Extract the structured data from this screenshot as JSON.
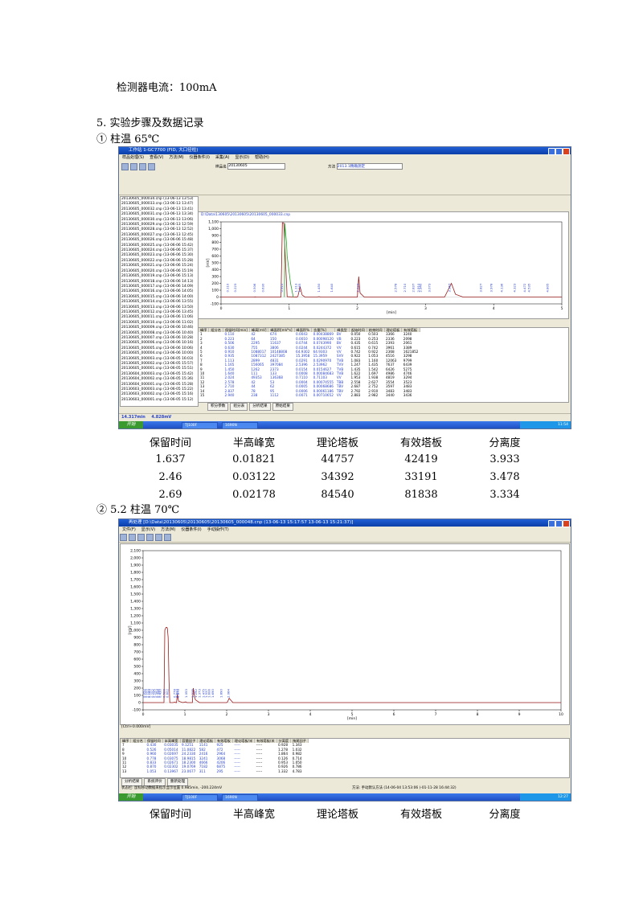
{
  "doc": {
    "detector_current": "检测器电流：100mA",
    "section_heading": "5.  实验步骤及数据记录",
    "item1": "①  柱温 65℃",
    "item2": "②  5.2 柱温 70℃",
    "table_headers": [
      "保留时间",
      "半高峰宽",
      "理论塔板",
      "有效塔板",
      "分离度"
    ],
    "table_rows": [
      [
        "1.637",
        "0.01821",
        "44757",
        "42419",
        "3.933"
      ],
      [
        "2.46",
        "0.03122",
        "34392",
        "33191",
        "3.478"
      ],
      [
        "2.69",
        "0.02178",
        "84540",
        "81838",
        "3.334"
      ]
    ],
    "table2_headers": [
      "保留时间",
      "半高峰宽",
      "理论塔板",
      "有效塔板",
      "分离度"
    ]
  },
  "shot1": {
    "title": "工作站 1-GC7700 (FID, 大口径柱)",
    "menu": [
      "样品处理(S)",
      "查看(V)",
      "方法(M)",
      "仪器条件(I)",
      "采集(A)",
      "显示(D)",
      "帮助(H)"
    ],
    "sample_label": "样品名",
    "sample_value": "20130605",
    "method_label": "方法",
    "method_value": "2013.1精确测定",
    "file_path": "D:\\Data\\130605\\20130605\\20130605_000033.cnp",
    "side_files": [
      "20130605_000034.cnp (13-06-13 13:53)",
      "20130605_000033.cnp (13-06-13 13:47)",
      "20130605_000032.cnp (13-06-13 13:41)",
      "20130605_000031.cnp (13-06-13 13:34)",
      "20130605_000030.cnp (13-06-13 13:06)",
      "20130605_000029.cnp (13-06-13 12:59)",
      "20130605_000028.cnp (13-06-13 12:52)",
      "20130605_000027.cnp (13-06-13 12:45)",
      "20130605_000026.cnp (13-06-06 15:48)",
      "20130605_000025.cnp (13-06-06 15:42)",
      "20130605_000024.cnp (13-06-06 15:37)",
      "20130605_000023.cnp (13-06-06 15:30)",
      "20130605_000022.cnp (13-06-06 15:28)",
      "20130605_000021.cnp (13-06-06 15:24)",
      "20130605_000020.cnp (13-06-06 15:19)",
      "20130605_000019.cnp (13-06-06 15:13)",
      "20130605_000018.cnp (13-06-06 14:13)",
      "20130605_000017.cnp (13-06-06 14:09)",
      "20130605_000016.cnp (13-06-06 14:05)",
      "20130605_000015.cnp (13-06-06 14:00)",
      "20130605_000014.cnp (13-06-06 13:55)",
      "20130605_000013.cnp (13-06-06 13:50)",
      "20130605_000012.cnp (13-06-06 13:45)",
      "20130605_000011.cnp (13-06-06 11:06)",
      "20130605_000010.cnp (13-06-06 11:02)",
      "20130605_000009.cnp (13-06-06 10:46)",
      "20130605_000008.cnp (13-06-06 10:40)",
      "20130605_000007.cnp (13-06-06 10:28)",
      "20130605_000006.cnp (13-06-06 10:16)",
      "20130605_000005.cnp (13-06-06 10:06)",
      "20130605_000004.cnp (13-06-06 10:00)",
      "20130605_000003.cnp (13-06-05 16:03)",
      "20130605_000002.cnp (13-06-05 15:57)",
      "20130605_000001.cnp (13-06-05 15:51)",
      "20130604_000003.cnp (13-06-05 15:42)",
      "20130604_000002.cnp (13-06-05 15:36)",
      "20130604_000001.cnp (13-06-05 15:28)",
      "20130603_000003.cnp (13-06-05 15:22)",
      "20130603_000002.cnp (13-06-05 15:16)",
      "20130603_000001.cnp (13-06-05 15:12)"
    ],
    "status_time": "14.317min",
    "status_value": "4.828mV",
    "tabs": [
      "积分参数",
      "组分表",
      "分析结果",
      "原始结果"
    ],
    "table_headers": [
      "峰序",
      "组分名",
      "保留时间[min]",
      "峰高[mV]",
      "峰面积[mV*s]",
      "峰面积%",
      "含量[%]",
      "峰类型",
      "起始时间",
      "结束时间",
      "理论塔板",
      "有效塔板"
    ],
    "table_rows": [
      [
        "1",
        "",
        "0.110",
        "42",
        "674",
        "0.0043",
        "0.00438869",
        "BV",
        "0.050",
        "0.503",
        "3366",
        "3240"
      ],
      [
        "2",
        "",
        "0.223",
        "64",
        "150",
        "0.0010",
        "0.00098120",
        "VB",
        "0.223",
        "0.253",
        "2336",
        "2098"
      ],
      [
        "3",
        "",
        "0.506",
        "2295",
        "11637",
        "0.0744",
        "0.0743990",
        "BV",
        "0.435",
        "0.615",
        "2393",
        "2061"
      ],
      [
        "4",
        "",
        "0.630",
        "755",
        "3806",
        "0.0244",
        "0.0244372",
        "VV",
        "0.615",
        "0.742",
        "3961",
        "3389"
      ],
      [
        "5",
        "",
        "0.910",
        "1088017",
        "10148808",
        "64.9302",
        "64.9303",
        "VV",
        "0.742",
        "0.922",
        "2368",
        "1621852"
      ],
      [
        "6",
        "",
        "0.935",
        "1087312",
        "2427385",
        "15.3958",
        "15.3959",
        "SVV",
        "0.922",
        "1.053",
        "4516",
        "3298"
      ],
      [
        "7",
        "",
        "1.113",
        "2899",
        "4831",
        "0.0291",
        "0.0290970",
        "TVB",
        "1.083",
        "1.160",
        "12063",
        "9799"
      ],
      [
        "8",
        "",
        "1.165",
        "156065",
        "397084",
        "2.5396",
        "2.53962",
        "TVV",
        "1.247",
        "1.435",
        "7637",
        "6439"
      ],
      [
        "9",
        "",
        "1.450",
        "1262",
        "2373",
        "0.0154",
        "0.0154627",
        "TVB",
        "1.435",
        "1.542",
        "6426",
        "5275"
      ],
      [
        "10",
        "",
        "1.640",
        "111",
        "133",
        "0.0008",
        "0.00084683",
        "TVB",
        "1.622",
        "1.697",
        "4986",
        "4746"
      ],
      [
        "11",
        "",
        "2.024",
        "49353",
        "136368",
        "0.7110",
        "0.71103",
        "VV",
        "1.953",
        "1.938",
        "4819",
        "3294"
      ],
      [
        "12",
        "",
        "2.578",
        "42",
        "53",
        "0.0004",
        "0.00074555",
        "TBB",
        "2.558",
        "2.627",
        "3554",
        "3523"
      ],
      [
        "13",
        "",
        "2.710",
        "44",
        "62",
        "0.0005",
        "0.00068686",
        "TBV",
        "2.687",
        "2.752",
        "3597",
        "3483"
      ],
      [
        "14",
        "",
        "2.837",
        "78",
        "95",
        "0.0006",
        "0.00061186",
        "TBV",
        "2.792",
        "2.910",
        "3483",
        "3483"
      ],
      [
        "15",
        "",
        "2.940",
        "238",
        "1112",
        "0.0071",
        "0.00710652",
        "VV",
        "2.883",
        "2.982",
        "3440",
        "3436"
      ]
    ]
  },
  "shot2": {
    "title": "再处理 [D:\\Data\\20130605\\20130605\\20130605_000048.cnp (13-06-13 15:17:57 13-06-13 15:21:37)]",
    "menu": [
      "文件(F)",
      "显示(V)",
      "方法(M)",
      "仪器条件(I)",
      "手动操作(T)"
    ],
    "status_left": "[Ctrl+0.000mV]",
    "status_right": "方法: 手动默认方法 (14-06-04 13:53:06 )-01-11-28 16:44:32)",
    "status_bottom": "状态栏: 鼠标移动数据来指示显示位置 0.985min, -200.224mV",
    "tabs": [
      "分析结果",
      "系统评价",
      "重新处理"
    ],
    "table_headers": [
      "峰序",
      "组分名",
      "保留时间",
      "半高峰宽",
      "容量因子",
      "理论塔板",
      "有效塔板",
      "理论塔板/米",
      "有效塔板/米",
      "分离度",
      "拖尾因子"
    ],
    "table_rows": [
      [
        "7",
        "",
        "0.430",
        "0.03035",
        "9.1251",
        "1141",
        "925",
        "-----",
        "-----",
        "0.928",
        "1.343"
      ],
      [
        "8",
        "",
        "0.526",
        "0.05014",
        "11.0822",
        "582",
        "472",
        "-----",
        "-----",
        "1.278",
        "1.032"
      ],
      [
        "9",
        "",
        "0.960",
        "0.02697",
        "24.2330",
        "2416",
        "2964",
        "-----",
        "-----",
        "1.864",
        "0.982"
      ],
      [
        "10",
        "",
        "0.778",
        "0.03075",
        "18.9815",
        "3241",
        "3068",
        "-----",
        "-----",
        "0.126",
        "0.714"
      ],
      [
        "11",
        "",
        "0.833",
        "0.02671",
        "18.2300",
        "4666",
        "4206",
        "-----",
        "-----",
        "0.953",
        "1.050"
      ],
      [
        "12",
        "",
        "0.870",
        "0.02302",
        "19.0769",
        "7182",
        "6875",
        "-----",
        "-----",
        "0.926",
        "0.786"
      ],
      [
        "13",
        "",
        "1.053",
        "0.13967",
        "23.0677",
        "311",
        "295",
        "-----",
        "-----",
        "1.332",
        "4.783"
      ]
    ]
  },
  "taskbar": {
    "start": "开始",
    "task1": "TJ100F",
    "task2": "1690N",
    "time1": "11:54",
    "time2": "12:27"
  },
  "chart_data": [
    {
      "type": "line",
      "xlim": [
        0,
        5
      ],
      "ylim": [
        -100,
        1100
      ],
      "y_ticks": [
        -100,
        0,
        100,
        200,
        300,
        400,
        500,
        600,
        700,
        800,
        900,
        1000,
        1100
      ],
      "y_tick_labels": [
        "-100",
        "0",
        "100",
        "200",
        "300",
        "400",
        "500",
        "600",
        "700",
        "800",
        "900",
        "1,000",
        "1,100"
      ],
      "x_ticks": [
        0,
        1,
        2,
        3,
        4,
        5
      ],
      "xlabel": "[min]",
      "ylabel": "[mV]",
      "series": [
        {
          "values_x": [
            0,
            0.4,
            0.48,
            0.5,
            0.52,
            0.6,
            0.88,
            0.9,
            0.92,
            0.97,
            1.08,
            1.1,
            1.12,
            1.13,
            1.16,
            1.19,
            1.23,
            1.4,
            1.44,
            1.46,
            1.5,
            2.0,
            2.02,
            2.04,
            2.1,
            2.2,
            3.28,
            3.33,
            3.38,
            3.44,
            3.55,
            5
          ],
          "values_y": [
            0,
            0,
            0,
            2,
            0,
            0,
            0,
            1088,
            1086,
            5,
            0,
            2,
            0,
            20,
            150,
            30,
            0,
            0,
            5,
            0,
            0,
            0,
            300,
            60,
            0,
            0,
            0,
            100,
            200,
            40,
            0,
            0
          ]
        },
        {
          "values_x": [
            0.93,
            0.935,
            0.96,
            0.97,
            1.02,
            1.06
          ],
          "values_y": [
            0,
            1080,
            800,
            600,
            200,
            0
          ]
        }
      ],
      "peak_labels": [
        "0.110",
        "0.223",
        "0.506",
        "0.630",
        "0.910",
        "1.113",
        "1.165",
        "1.450",
        "1.640",
        "2.024",
        "2.578",
        "2.710",
        "2.837",
        "2.910",
        "2.940",
        "3.073",
        "3.367",
        "3.827",
        "3.978",
        "4.136",
        "4.323",
        "4.472",
        "4.535",
        "4.805",
        "5.178"
      ]
    },
    {
      "type": "line",
      "xlim": [
        0,
        10
      ],
      "ylim": [
        -100,
        2100
      ],
      "y_ticks": [
        -100,
        0,
        100,
        200,
        300,
        400,
        500,
        600,
        700,
        800,
        900,
        1000,
        1100,
        1200,
        1300,
        1400,
        1500,
        1600,
        1700,
        1800,
        1900,
        2000,
        2100
      ],
      "y_tick_labels": [
        "-100",
        "0",
        "100",
        "200",
        "300",
        "400",
        "500",
        "600",
        "700",
        "800",
        "900",
        "1,000",
        "1,100",
        "1,200",
        "1,300",
        "1,400",
        "1,500",
        "1,600",
        "1,700",
        "1,800",
        "1,900",
        "2,000",
        "2,100"
      ],
      "x_ticks": [
        0,
        1,
        2,
        3,
        4,
        5,
        6,
        7,
        8,
        9,
        10
      ],
      "xlabel": "[min]",
      "ylabel": "[mV]",
      "series": [
        {
          "values_x": [
            0,
            0.5,
            0.52,
            0.55,
            0.57,
            0.58,
            0.6,
            0.62,
            0.64,
            0.68,
            0.72,
            0.75,
            0.8,
            0.82,
            0.85,
            0.95,
            1.02,
            1.05,
            1.1,
            1.18,
            1.2,
            1.25,
            1.35,
            2.0,
            2.02,
            2.06,
            2.15,
            10
          ],
          "values_y": [
            0,
            0,
            1000,
            1040,
            1040,
            1030,
            900,
            300,
            0,
            0,
            0,
            5,
            0,
            110,
            20,
            0,
            10,
            0,
            0,
            0,
            200,
            40,
            0,
            0,
            8,
            60,
            0,
            0
          ]
        }
      ],
      "peak_labels": [
        "0.052",
        "0.100",
        "0.150",
        "0.183",
        "0.252",
        "0.295",
        "0.353",
        "0.396",
        "0.430",
        "0.526",
        "0.602",
        "0.778",
        "0.833",
        "0.870",
        "1.053",
        "1.215",
        "1.292",
        "1.373",
        "1.475",
        "1.537",
        "1.606",
        "1.690",
        "1.890",
        "2.064"
      ]
    }
  ]
}
